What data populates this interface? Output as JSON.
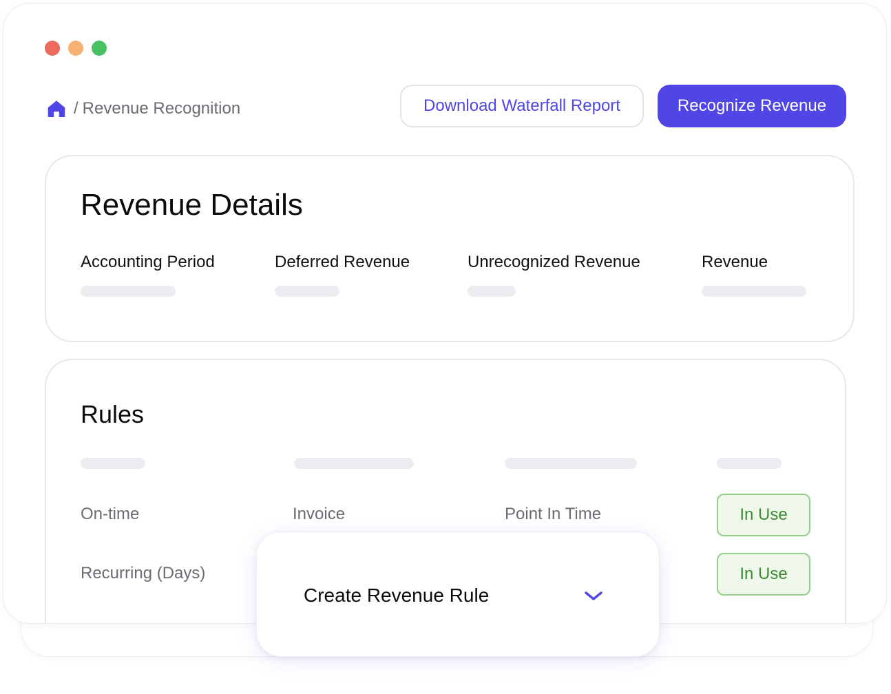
{
  "window": {
    "controls": {
      "close_color": "#ec6a5e",
      "minimize_color": "#f5b273",
      "maximize_color": "#46c263"
    }
  },
  "breadcrumb": {
    "home_icon": "home-icon",
    "separator": "/",
    "current": "Revenue Recognition"
  },
  "toolbar": {
    "download_label": "Download Waterfall Report",
    "recognize_label": "Recognize Revenue",
    "accent_color": "#4f46e5"
  },
  "details": {
    "title": "Revenue Details",
    "columns": [
      {
        "label": "Accounting Period"
      },
      {
        "label": "Deferred Revenue"
      },
      {
        "label": "Unrecognized Revenue"
      },
      {
        "label": "Revenue"
      }
    ]
  },
  "rules": {
    "title": "Rules",
    "rows": [
      {
        "name": "On-time",
        "trigger": "Invoice",
        "recognition": "Point In Time",
        "status": "In Use"
      },
      {
        "name": "Recurring (Days)",
        "trigger": "",
        "recognition": "",
        "status": "In Use"
      }
    ],
    "status_color": "#3f8a36"
  },
  "popup": {
    "label": "Create Revenue Rule",
    "icon": "chevron-down-icon"
  }
}
